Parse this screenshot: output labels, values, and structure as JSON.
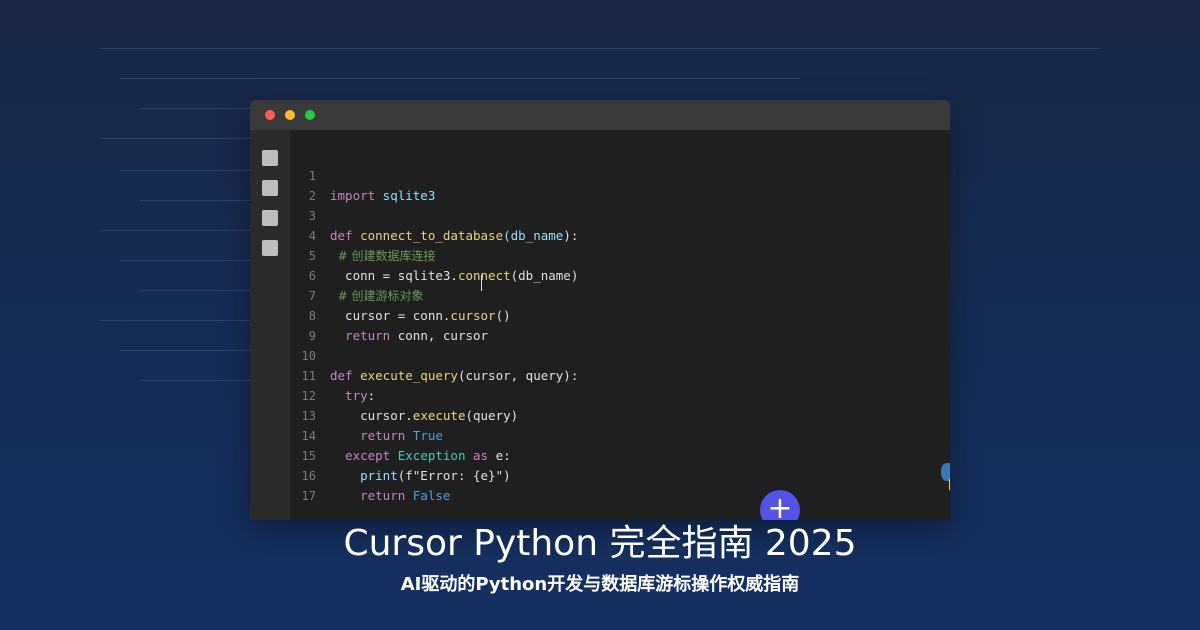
{
  "page": {
    "title": "Cursor Python 完全指南 2025",
    "subtitle": "AI驱动的Python开发与数据库游标操作权威指南"
  },
  "colors": {
    "background_top": "#1a2746",
    "background_bottom": "#143062",
    "editor_bg": "#1f1f1f",
    "titlebar_bg": "#3a3a3a",
    "accent_button": "#5552e8",
    "keyword": "#c586c0",
    "function": "#e6d38a",
    "comment": "#6a9955",
    "class": "#4ec9b0",
    "boolean": "#569cd6"
  },
  "editor": {
    "window_controls": [
      "close-dot",
      "minimize-dot",
      "maximize-dot"
    ],
    "activity_icons": [
      "explorer-icon",
      "search-icon",
      "source-control-icon",
      "extensions-icon"
    ],
    "line_numbers": [
      "1",
      "2",
      "3",
      "4",
      "5",
      "6",
      "7",
      "8",
      "9",
      "10",
      "11",
      "12",
      "13",
      "14",
      "15",
      "16",
      "17"
    ],
    "code": {
      "l1": {
        "kw": "import",
        "rest": " sqlite3"
      },
      "l3": {
        "kw": "def",
        "fn": " connect_to_database",
        "param": "(db_name",
        "rest": "):"
      },
      "l4": {
        "comment": "  # 创建数据库连接"
      },
      "l5": {
        "rest": "  conn = sqlite3.",
        "fn": "connect",
        "tail": "(db_name)"
      },
      "l6": {
        "comment": "  # 创建游标对象"
      },
      "l7": {
        "rest": "  cursor = conn.",
        "fn": "cursor",
        "tail": "()"
      },
      "l8": {
        "kw": "  return",
        "rest": " conn, cursor"
      },
      "l10": {
        "kw": "def",
        "fn": " execute_query",
        "rest": "(cursor, query):"
      },
      "l11": {
        "kw": "  try",
        "rest": ":"
      },
      "l12": {
        "rest": "    cursor.",
        "fn": "execute",
        "tail": "(query)"
      },
      "l13": {
        "kw": "    return",
        "bool": " True"
      },
      "l14": {
        "kw": "  except",
        "cls": " Exception",
        "kw2": " as",
        "rest": " e:"
      },
      "l15": {
        "fn": "    print",
        "rest": "(f\"Error: {e}\")"
      },
      "l16": {
        "kw": "    return",
        "bool": " False"
      }
    },
    "language_icon": "python-logo-icon",
    "fab_label": "+"
  }
}
